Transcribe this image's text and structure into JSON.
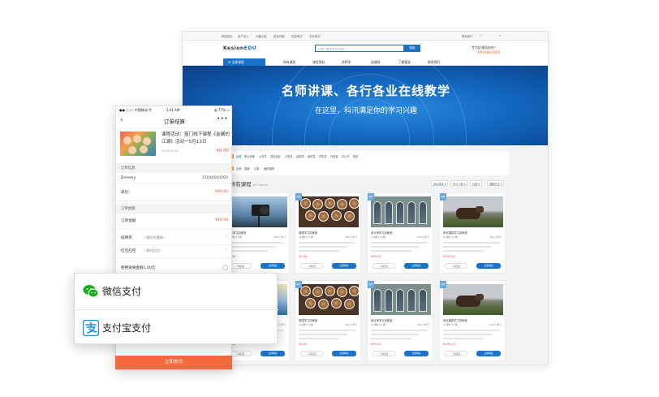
{
  "desktop": {
    "topbar": [
      "网站首页",
      "用户中心",
      "兴趣小组",
      "投诉问题",
      "在线考试",
      "手机考试"
    ],
    "topbar_right": [
      "联系我们"
    ],
    "brand_prefix": "Kesion",
    "brand_suffix": "EDU",
    "search_placeholder": "请输入要搜索的关键词",
    "search_button": "搜索",
    "hotline_label": "专为好课而存在！",
    "hotline_number": "400-008-0263",
    "category_button": "全部课程",
    "nav": [
      "所有课程",
      "课程资料",
      "讲师名",
      "选课网",
      "了解更多",
      "联系我们"
    ],
    "banner_title": "名师讲课、各行各业在线教学",
    "banner_subtitle": "在这里，科汛满足你的学习兴趣",
    "filter_row1_label": "分类",
    "filter_row1": [
      "全部",
      "职业资格",
      "公务员",
      "语言培训",
      "计算机",
      "建筑类",
      "医药类",
      "学历类",
      "外语类",
      "中小学",
      "更多"
    ],
    "filter_row2_label": "类型",
    "filter_row2": [
      "全部",
      "直播",
      "点播",
      "面授课程"
    ],
    "course_heading": "所有课程",
    "course_heading_sub": "All Course",
    "sort_buttons": [
      "综合排序",
      "学习人数",
      "价格",
      "课程时长"
    ],
    "cards": [
      {
        "title": "摄影学习训练营",
        "meta": "22课时 12课",
        "count": "265人学习",
        "price": "¥0.00",
        "detail": "了解更多",
        "buy": "立即购买"
      },
      {
        "title": "咖啡学习训练营",
        "meta": "22课时 12课",
        "count": "265人学习",
        "price": "¥0.00",
        "detail": "了解更多",
        "buy": "立即购买"
      },
      {
        "title": "设计师学习训练营",
        "meta": "22课时 12课",
        "count": "265人学习",
        "price": "¥99.00",
        "detail": "了解更多",
        "buy": "立即购买"
      },
      {
        "title": "风光摄影学习训练营",
        "meta": "22课时 12课",
        "count": "265人学习",
        "price": "¥199.00",
        "detail": "了解更多",
        "buy": "立即购买"
      },
      {
        "title": "摄影学习训练营",
        "meta": "22课时 12课",
        "count": "265人学习",
        "price": "¥0.00",
        "detail": "了解更多",
        "buy": "立即购买"
      },
      {
        "title": "咖啡学习训练营",
        "meta": "22课时 12课",
        "count": "265人学习",
        "price": "¥0.00",
        "detail": "了解更多",
        "buy": "立即购买"
      },
      {
        "title": "设计师学习训练营",
        "meta": "22课时 12课",
        "count": "265人学习",
        "price": "¥99.00",
        "detail": "了解更多",
        "buy": "立即购买"
      },
      {
        "title": "风光摄影学习训练营",
        "meta": "22课时 12课",
        "count": "265人学习",
        "price": "¥199.00",
        "detail": "了解更多",
        "buy": "立即购买"
      }
    ],
    "card_tag": "推荐"
  },
  "phone": {
    "carrier": "●●○○○ 中国移动 令",
    "time": "1:41 AM",
    "battery": "@ 77% ▭",
    "back": "‹",
    "title": "订单结算",
    "more": "•••",
    "course_title": "课程活动：篮门线下课程《金庸的江湖》活动一5月13日",
    "course_date": "2019.05.24",
    "course_price": "¥0.00",
    "section_order": "订单信息",
    "account_label": "Dmemy",
    "account_value": "15000000000",
    "unit_label": "单价：",
    "unit_value": "¥49.00",
    "section_amount": "订单金额",
    "amount_label": "订单金额",
    "amount_value": "¥49.00",
    "coupon_label": "抵用卷",
    "coupon_select": "--我的优惠卷--",
    "redpack_label": "红包红包",
    "redpack_select": "--我的红包--",
    "balance_label": "使用资质金额1.00元",
    "pay_button": "立即支付"
  },
  "payment": {
    "wechat_label": "微信支付",
    "alipay_label": "支付宝支付",
    "wechat_color": "#1aad19",
    "alipay_color": "#1296db"
  }
}
